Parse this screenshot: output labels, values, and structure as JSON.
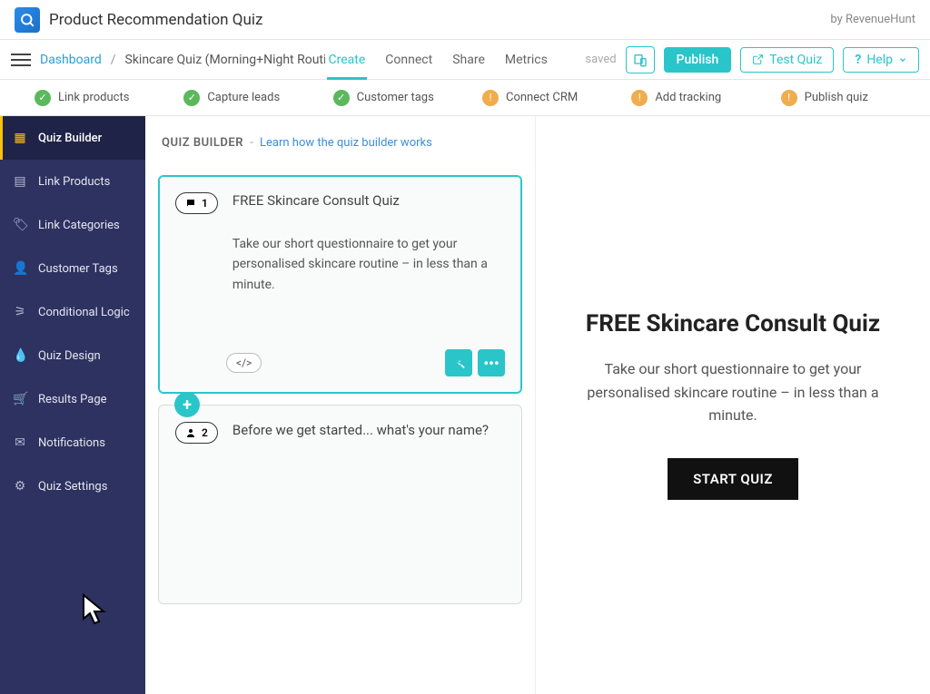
{
  "topbar": {
    "app_title": "Product Recommendation Quiz",
    "by": "by RevenueHunt"
  },
  "header": {
    "dashboard": "Dashboard",
    "quiz_name": "Skincare Quiz (Morning+Night Routines) (c",
    "tabs": {
      "create": "Create",
      "connect": "Connect",
      "share": "Share",
      "metrics": "Metrics"
    },
    "saved": "saved",
    "publish": "Publish",
    "test_quiz": "Test Quiz",
    "help": "Help"
  },
  "status": {
    "link_products": "Link products",
    "capture_leads": "Capture leads",
    "customer_tags": "Customer tags",
    "connect_crm": "Connect CRM",
    "add_tracking": "Add tracking",
    "publish_quiz": "Publish quiz"
  },
  "sidebar": {
    "quiz_builder": "Quiz Builder",
    "link_products": "Link Products",
    "link_categories": "Link Categories",
    "customer_tags": "Customer Tags",
    "conditional_logic": "Conditional Logic",
    "quiz_design": "Quiz Design",
    "results_page": "Results Page",
    "notifications": "Notifications",
    "quiz_settings": "Quiz Settings"
  },
  "middle": {
    "title": "QUIZ BUILDER",
    "sep": "-",
    "learn": "Learn how the quiz builder works",
    "q1": {
      "num": "1",
      "title": "FREE Skincare Consult Quiz",
      "desc": "Take our short questionnaire to get your personalised skincare routine – in less than a minute.",
      "code": "</>"
    },
    "q2": {
      "num": "2",
      "title": "Before we get started... what's your name?"
    },
    "add": "+"
  },
  "preview": {
    "title": "FREE Skincare Consult Quiz",
    "desc": "Take our short questionnaire to get your personalised skincare routine – in less than a minute.",
    "start": "START QUIZ"
  }
}
